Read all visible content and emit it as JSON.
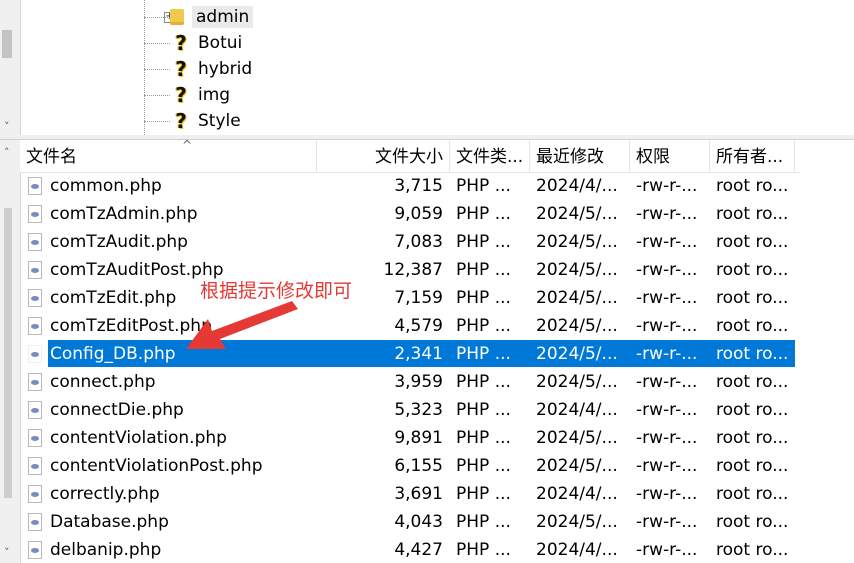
{
  "tree": {
    "items": [
      {
        "label": "admin",
        "icon": "folder-icon",
        "selected": true,
        "expandable": true
      },
      {
        "label": "Botui",
        "icon": "unknown-question-icon"
      },
      {
        "label": "hybrid",
        "icon": "unknown-question-icon"
      },
      {
        "label": "img",
        "icon": "unknown-question-icon"
      },
      {
        "label": "Style",
        "icon": "unknown-question-icon"
      }
    ]
  },
  "columns": {
    "name": "文件名",
    "size": "文件大小",
    "type": "文件类...",
    "modified": "最近修改",
    "perm": "权限",
    "owner": "所有者..."
  },
  "files": [
    {
      "name": "common.php",
      "size": "3,715",
      "type": "PHP ...",
      "modified": "2024/4/...",
      "perm": "-rw-r-...",
      "owner": "root ro..."
    },
    {
      "name": "comTzAdmin.php",
      "size": "9,059",
      "type": "PHP ...",
      "modified": "2024/5/...",
      "perm": "-rw-r-...",
      "owner": "root ro..."
    },
    {
      "name": "comTzAudit.php",
      "size": "7,083",
      "type": "PHP ...",
      "modified": "2024/5/...",
      "perm": "-rw-r-...",
      "owner": "root ro..."
    },
    {
      "name": "comTzAuditPost.php",
      "size": "12,387",
      "type": "PHP ...",
      "modified": "2024/5/...",
      "perm": "-rw-r-...",
      "owner": "root ro..."
    },
    {
      "name": "comTzEdit.php",
      "size": "7,159",
      "type": "PHP ...",
      "modified": "2024/5/...",
      "perm": "-rw-r-...",
      "owner": "root ro..."
    },
    {
      "name": "comTzEditPost.php",
      "size": "4,579",
      "type": "PHP ...",
      "modified": "2024/5/...",
      "perm": "-rw-r-...",
      "owner": "root ro..."
    },
    {
      "name": "Config_DB.php",
      "size": "2,341",
      "type": "PHP ...",
      "modified": "2024/5/...",
      "perm": "-rw-r-...",
      "owner": "root ro...",
      "selected": true
    },
    {
      "name": "connect.php",
      "size": "3,959",
      "type": "PHP ...",
      "modified": "2024/5/...",
      "perm": "-rw-r-...",
      "owner": "root ro..."
    },
    {
      "name": "connectDie.php",
      "size": "5,323",
      "type": "PHP ...",
      "modified": "2024/4/...",
      "perm": "-rw-r-...",
      "owner": "root ro..."
    },
    {
      "name": "contentViolation.php",
      "size": "9,891",
      "type": "PHP ...",
      "modified": "2024/5/...",
      "perm": "-rw-r-...",
      "owner": "root ro..."
    },
    {
      "name": "contentViolationPost.php",
      "size": "6,155",
      "type": "PHP ...",
      "modified": "2024/5/...",
      "perm": "-rw-r-...",
      "owner": "root ro..."
    },
    {
      "name": "correctly.php",
      "size": "3,691",
      "type": "PHP ...",
      "modified": "2024/4/...",
      "perm": "-rw-r-...",
      "owner": "root ro..."
    },
    {
      "name": "Database.php",
      "size": "4,043",
      "type": "PHP ...",
      "modified": "2024/5/...",
      "perm": "-rw-r-...",
      "owner": "root ro..."
    },
    {
      "name": "delbanip.php",
      "size": "4,427",
      "type": "PHP ...",
      "modified": "2024/4/...",
      "perm": "-rw-r-...",
      "owner": "root ro..."
    }
  ],
  "annotation": {
    "text": "根据提示修改即可",
    "color": "#e53935"
  },
  "colors": {
    "selection": "#0078d7",
    "folder": "#f2c94c"
  }
}
